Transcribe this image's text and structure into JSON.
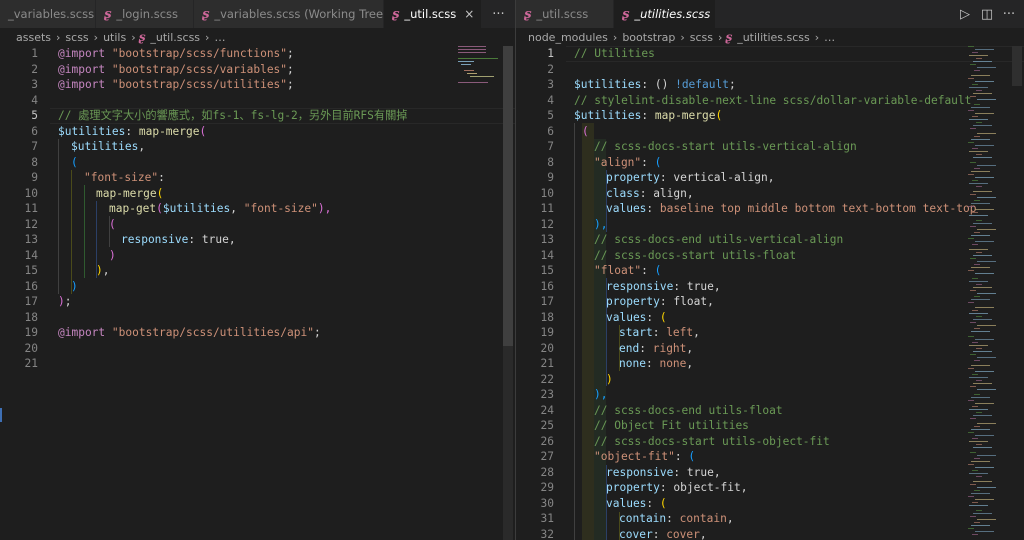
{
  "left": {
    "tabs": [
      {
        "label": "_variables.scss",
        "icon": "sass-icon",
        "active": false
      },
      {
        "label": "_login.scss",
        "icon": "sass-icon",
        "active": false
      },
      {
        "label": "_variables.scss (Working Tree)",
        "icon": "sass-icon",
        "active": false
      },
      {
        "label": "_util.scss",
        "icon": "sass-icon",
        "active": true,
        "close": "×"
      }
    ],
    "more": "···",
    "breadcrumb": [
      "assets",
      "scss",
      "utils",
      "_util.scss",
      "…"
    ],
    "lines": [
      {
        "n": "1"
      },
      {
        "n": "2"
      },
      {
        "n": "3"
      },
      {
        "n": "4"
      },
      {
        "n": "5",
        "current": true
      },
      {
        "n": "6"
      },
      {
        "n": "7"
      },
      {
        "n": "8"
      },
      {
        "n": "9"
      },
      {
        "n": "10"
      },
      {
        "n": "11"
      },
      {
        "n": "12"
      },
      {
        "n": "13"
      },
      {
        "n": "14"
      },
      {
        "n": "15"
      },
      {
        "n": "16"
      },
      {
        "n": "17"
      },
      {
        "n": "18"
      },
      {
        "n": "19"
      },
      {
        "n": "20"
      },
      {
        "n": "21"
      }
    ],
    "code": {
      "l1_kw": "@import",
      "l1_str": "\"bootstrap/scss/functions\"",
      "semi": ";",
      "l2_str": "\"bootstrap/scss/variables\"",
      "l3_str": "\"bootstrap/scss/utilities\"",
      "l5_cm": "// 處理文字大小的響應式，如fs-1、fs-lg-2，另外目前RFS有關掉",
      "l6_var": "$utilities",
      "colon": ":",
      "mapmerge": "map-merge",
      "lparen": "(",
      "l7_var": "$utilities",
      "comma": ",",
      "l9_str": "\"font-size\"",
      "l11_fn": "map-get",
      "l11_var": "$utilities",
      "l11_str": "\"font-size\"",
      "rparen_comma": "),",
      "l13_prop": "responsive",
      "l13_val": "true",
      "rparen": ")",
      "rparen_semi": ");",
      "l19_str": "\"bootstrap/scss/utilities/api\""
    }
  },
  "right": {
    "tabs": [
      {
        "label": "_util.scss",
        "icon": "sass-icon",
        "active": false
      },
      {
        "label": "_utilities.scss",
        "icon": "sass-icon",
        "active": true,
        "close": "×"
      }
    ],
    "actions": {
      "run": "▷",
      "split": "◫",
      "more": "···"
    },
    "breadcrumb": [
      "node_modules",
      "bootstrap",
      "scss",
      "_utilities.scss",
      "…"
    ],
    "lines": [
      {
        "n": "1",
        "current": true
      },
      {
        "n": "2"
      },
      {
        "n": "3"
      },
      {
        "n": "4"
      },
      {
        "n": "5"
      },
      {
        "n": "6"
      },
      {
        "n": "7"
      },
      {
        "n": "8"
      },
      {
        "n": "9"
      },
      {
        "n": "10"
      },
      {
        "n": "11"
      },
      {
        "n": "12"
      },
      {
        "n": "13"
      },
      {
        "n": "14"
      },
      {
        "n": "15"
      },
      {
        "n": "16"
      },
      {
        "n": "17"
      },
      {
        "n": "18"
      },
      {
        "n": "19"
      },
      {
        "n": "20"
      },
      {
        "n": "21"
      },
      {
        "n": "22"
      },
      {
        "n": "23"
      },
      {
        "n": "24"
      },
      {
        "n": "25"
      },
      {
        "n": "26"
      },
      {
        "n": "27"
      },
      {
        "n": "28"
      },
      {
        "n": "29"
      },
      {
        "n": "30"
      },
      {
        "n": "31"
      },
      {
        "n": "32"
      }
    ],
    "code": {
      "l1": "// Utilities",
      "l3_var": "$utilities",
      "l3_rest": "() ",
      "l3_def": "!default",
      "semi": ";",
      "l4": "// stylelint-disable-next-line scss/dollar-variable-default",
      "l5_var": "$utilities",
      "mapmerge": "map-merge",
      "lparen": "(",
      "l7": "// scss-docs-start utils-vertical-align",
      "l8_str": "\"align\"",
      "colon": ":",
      "l9_prop": "property",
      "l9_val": "vertical-align",
      "comma": ",",
      "l10_prop": "class",
      "l10_val": "align",
      "l11_prop": "values",
      "l11_val": "baseline top middle bottom text-bottom text-top",
      "rparen_comma": "),",
      "l13": "// scss-docs-end utils-vertical-align",
      "l14": "// scss-docs-start utils-float",
      "l15_str": "\"float\"",
      "l16_prop": "responsive",
      "l16_val": "true",
      "l17_prop": "property",
      "l17_val": "float",
      "l18_prop": "values",
      "l19_prop": "start",
      "l19_val": "left",
      "l20_prop": "end",
      "l20_val": "right",
      "l21_prop": "none",
      "l21_val": "none",
      "rparen": ")",
      "l24": "// scss-docs-end utils-float",
      "l25": "// Object Fit utilities",
      "l26": "// scss-docs-start utils-object-fit",
      "l27_str": "\"object-fit\"",
      "l28_prop": "responsive",
      "l28_val": "true",
      "l29_prop": "property",
      "l29_val": "object-fit",
      "l30_prop": "values",
      "l31_prop": "contain",
      "l31_val": "contain",
      "l32_prop": "cover",
      "l32_val": "cover"
    }
  },
  "colors": {
    "background": "#1e1e1e",
    "tab_bar": "#252526",
    "sass_icon": "#cd6799",
    "comment": "#6a9955",
    "string": "#ce9178",
    "keyword": "#c586c0"
  }
}
